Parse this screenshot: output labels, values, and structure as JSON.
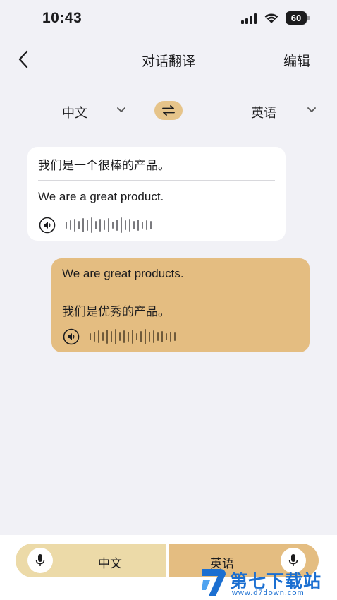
{
  "status_bar": {
    "time": "10:43",
    "battery": "60"
  },
  "nav": {
    "title": "对话翻译",
    "edit_label": "编辑"
  },
  "language_bar": {
    "source": "中文",
    "target": "英语"
  },
  "messages": [
    {
      "source_text": "我们是一个很棒的产品。",
      "translated_text": "We are a great product."
    },
    {
      "source_text": "We are great products.",
      "translated_text": "我们是优秀的产品。"
    }
  ],
  "bottom": {
    "left_label": "中文",
    "right_label": "英语"
  },
  "watermark": {
    "title": "第七下载站",
    "url": "www.d7down.com"
  },
  "colors": {
    "background": "#f1f1f6",
    "accent": "#e4bd81",
    "accent_light": "#ecdaa8",
    "watermark": "#1b6fd1"
  },
  "icons": [
    "back-chevron-icon",
    "swap-arrows-icon",
    "chevron-down-icon",
    "speaker-icon",
    "waveform-icon",
    "microphone-icon"
  ]
}
